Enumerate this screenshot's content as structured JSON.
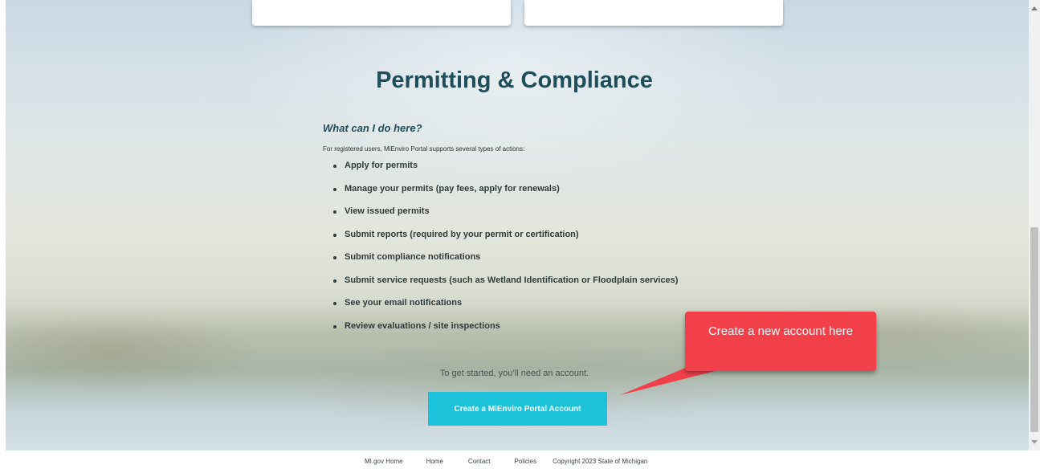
{
  "main": {
    "title": "Permitting & Compliance",
    "subheading": "What can I do here?",
    "intro": "For registered users, MiEnviro Portal supports several types of actions:",
    "actions": [
      "Apply for permits",
      "Manage your permits (pay fees, apply for renewals)",
      "View issued permits",
      "Submit reports (required by your permit or certification)",
      "Submit compliance notifications",
      "Submit service requests (such as Wetland Identification or Floodplain services)",
      "See your email notifications",
      "Review evaluations / site inspections"
    ],
    "get_started": "To get started, you’ll need an account.",
    "create_button": "Create a MiEnviro Portal Account"
  },
  "callout": {
    "text": "Create a new account here"
  },
  "footer": {
    "links": [
      "MI.gov Home",
      "Home",
      "Contact",
      "Policies"
    ],
    "copyright": "Copyright 2023 State of Michigan"
  },
  "colors": {
    "title": "#1f4e5a",
    "button": "#1bc2d9",
    "callout": "#f2404a"
  }
}
